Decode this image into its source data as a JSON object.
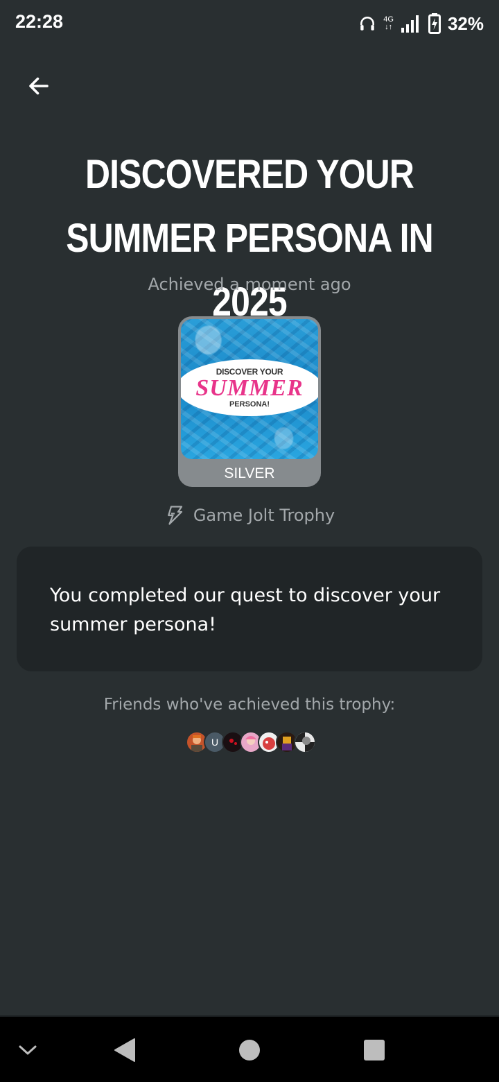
{
  "status_bar": {
    "time": "22:28",
    "network": "4G",
    "battery_percent": "32%",
    "icons": [
      "headphones-icon",
      "network-4g-icon",
      "signal-icon",
      "battery-charging-icon"
    ]
  },
  "header": {
    "back_icon": "arrow-left-icon"
  },
  "trophy": {
    "title": "DISCOVERED YOUR SUMMER PERSONA IN 2025",
    "achieved": "Achieved a moment ago",
    "badge": {
      "banner_top": "DISCOVER YOUR",
      "banner_main": "SUMMER",
      "banner_bottom": "PERSONA!"
    },
    "tier": "SILVER",
    "type_icon": "game-jolt-bolt-icon",
    "type_label": "Game Jolt Trophy",
    "description": "You completed our quest to discover your summer persona!"
  },
  "friends": {
    "label": "Friends who've achieved this trophy:",
    "avatars": [
      {
        "initial": "",
        "color": "#c4532a"
      },
      {
        "initial": "U",
        "color": "#4a5a66"
      },
      {
        "initial": "",
        "color": "#1a0f12"
      },
      {
        "initial": "",
        "color": "#e8a8c8"
      },
      {
        "initial": "",
        "color": "#d84040"
      },
      {
        "initial": "",
        "color": "#2a1a12"
      },
      {
        "initial": "",
        "color": "#e8e8e8"
      }
    ]
  },
  "nav_bar": {
    "icons": [
      "chevron-down-icon",
      "back-triangle-icon",
      "home-circle-icon",
      "recents-square-icon"
    ]
  },
  "colors": {
    "background": "#292f31",
    "card": "#202527",
    "muted_text": "#a3a8ab",
    "tier_silver": "#868b8e",
    "accent_pink": "#e8348a"
  }
}
